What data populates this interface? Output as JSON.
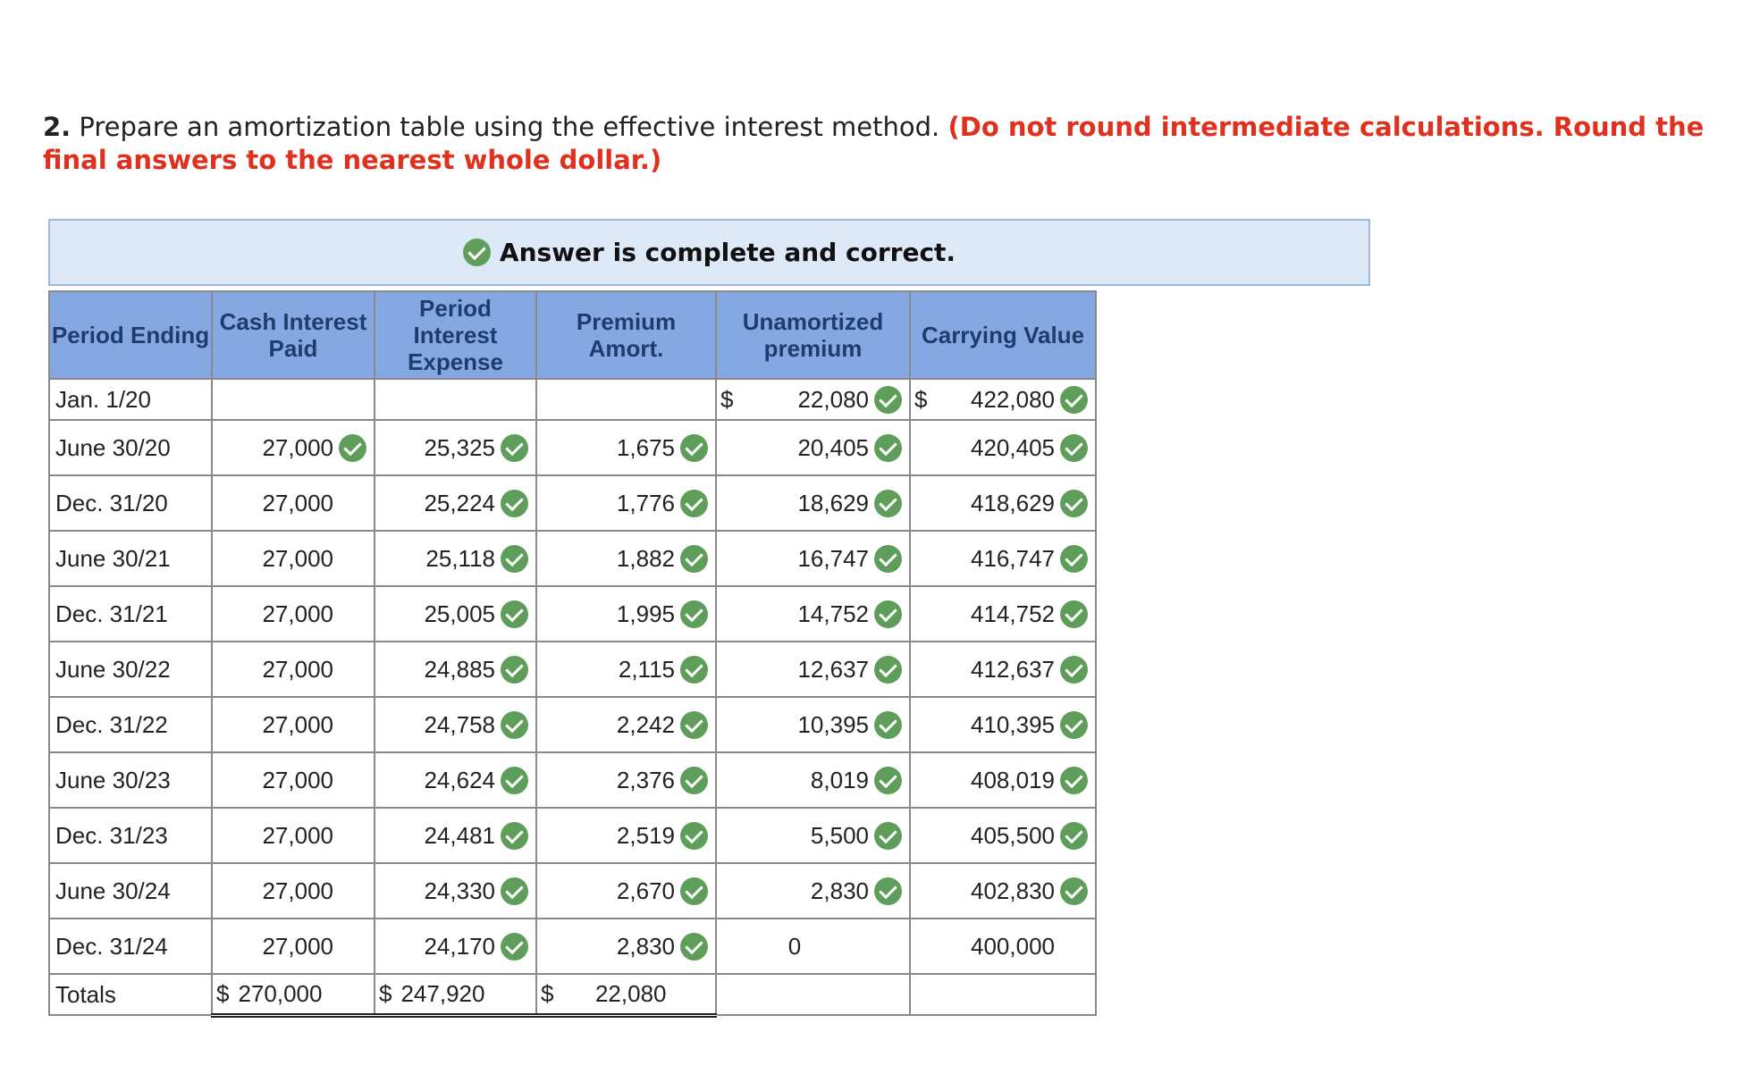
{
  "instruction": {
    "number": "2.",
    "text": " Prepare an amortization table using the effective interest method. ",
    "note": "(Do not round intermediate calculations. Round the final answers to the nearest whole dollar.)"
  },
  "banner": {
    "text": "Answer is complete and correct."
  },
  "table": {
    "headers": {
      "period": "Period Ending",
      "cash": "Cash Interest Paid",
      "expense": "Period Interest Expense",
      "premium": "Premium Amort.",
      "unamortized": "Unamortized premium",
      "carrying": "Carrying Value"
    },
    "currency": "$",
    "first_row": {
      "period": "Jan. 1/20",
      "unamortized": "22,080",
      "carrying": "422,080"
    },
    "rows": [
      {
        "period": "June 30/20",
        "cash": "27,000",
        "expense": "25,325",
        "premium": "1,675",
        "unamortized": "20,405",
        "carrying": "420,405"
      },
      {
        "period": "Dec. 31/20",
        "cash": "27,000",
        "expense": "25,224",
        "premium": "1,776",
        "unamortized": "18,629",
        "carrying": "418,629"
      },
      {
        "period": "June 30/21",
        "cash": "27,000",
        "expense": "25,118",
        "premium": "1,882",
        "unamortized": "16,747",
        "carrying": "416,747"
      },
      {
        "period": "Dec. 31/21",
        "cash": "27,000",
        "expense": "25,005",
        "premium": "1,995",
        "unamortized": "14,752",
        "carrying": "414,752"
      },
      {
        "period": "June 30/22",
        "cash": "27,000",
        "expense": "24,885",
        "premium": "2,115",
        "unamortized": "12,637",
        "carrying": "412,637"
      },
      {
        "period": "Dec. 31/22",
        "cash": "27,000",
        "expense": "24,758",
        "premium": "2,242",
        "unamortized": "10,395",
        "carrying": "410,395"
      },
      {
        "period": "June 30/23",
        "cash": "27,000",
        "expense": "24,624",
        "premium": "2,376",
        "unamortized": "8,019",
        "carrying": "408,019"
      },
      {
        "period": "Dec. 31/23",
        "cash": "27,000",
        "expense": "24,481",
        "premium": "2,519",
        "unamortized": "5,500",
        "carrying": "405,500"
      },
      {
        "period": "June 30/24",
        "cash": "27,000",
        "expense": "24,330",
        "premium": "2,670",
        "unamortized": "2,830",
        "carrying": "402,830"
      },
      {
        "period": "Dec. 31/24",
        "cash": "27,000",
        "expense": "24,170",
        "premium": "2,830",
        "unamortized": "0",
        "carrying": "400,000"
      }
    ],
    "totals": {
      "label": "Totals",
      "cash": "270,000",
      "expense": "247,920",
      "premium": "22,080"
    }
  },
  "colors": {
    "header_bg": "#86a8e2",
    "check_green": "#5e9e5a",
    "banner_bg": "#dde9f6",
    "instruction_red": "#e0301e"
  },
  "icons": {
    "correct": "check-circle-icon"
  }
}
